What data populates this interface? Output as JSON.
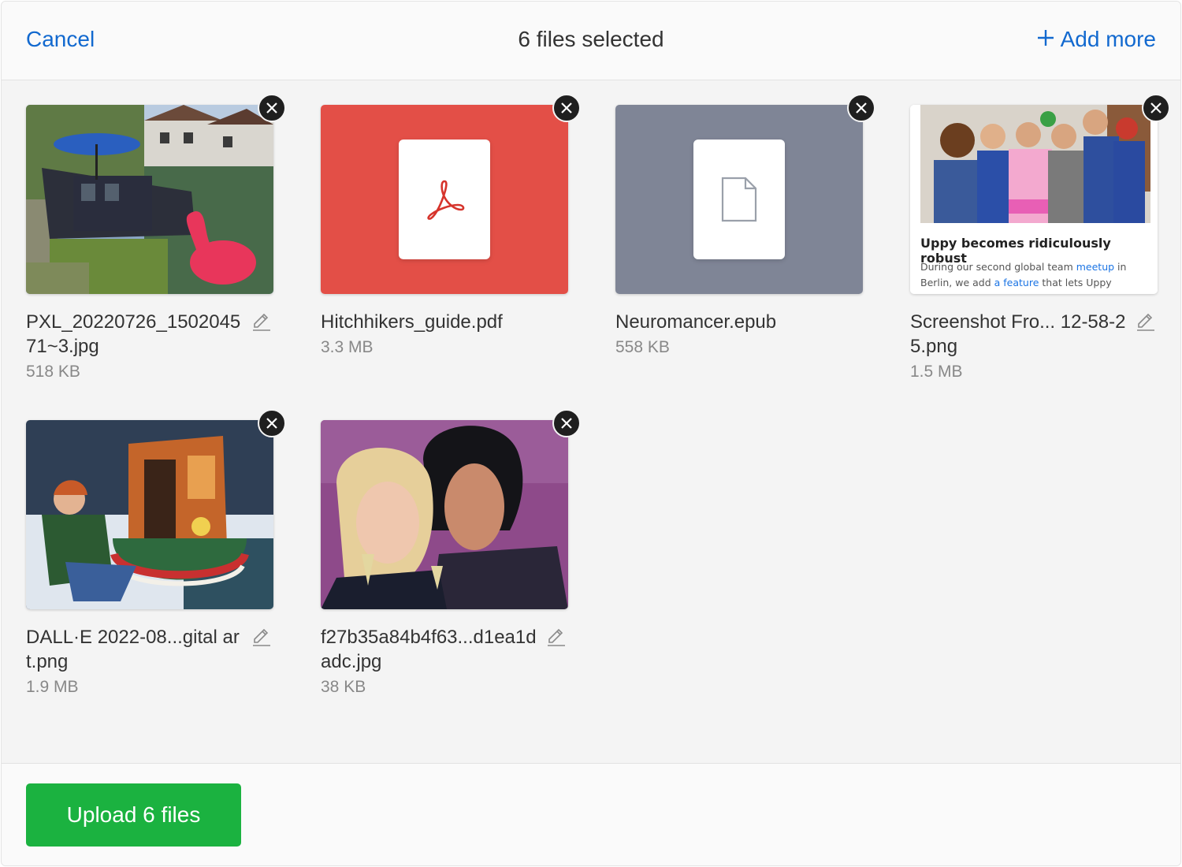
{
  "header": {
    "cancel_label": "Cancel",
    "title": "6 files selected",
    "add_more_label": "Add more"
  },
  "files": [
    {
      "name": "PXL_20220726_150204571~3.jpg",
      "size": "518 KB",
      "kind": "image",
      "editable": true
    },
    {
      "name": "Hitchhikers_guide.pdf",
      "size": "3.3 MB",
      "kind": "pdf",
      "editable": false
    },
    {
      "name": "Neuromancer.epub",
      "size": "558 KB",
      "kind": "generic",
      "editable": false
    },
    {
      "name": "Screenshot Fro... 12-58-25.png",
      "size": "1.5 MB",
      "kind": "image",
      "editable": true
    },
    {
      "name": "DALL·E 2022-08...gital art.png",
      "size": "1.9 MB",
      "kind": "image",
      "editable": true
    },
    {
      "name": "f27b35a84b4f63...d1ea1dadc.jpg",
      "size": "38 KB",
      "kind": "image",
      "editable": true
    }
  ],
  "screenshot_preview": {
    "headline": "Uppy becomes ridiculously robust",
    "body_1": "During our second global team ",
    "link_1": "meetup",
    "body_2": " in Berlin, we add ",
    "link_2": "a feature",
    "body_3": " that lets Uppy recover from unstable networks (two-powered) and browser"
  },
  "footer": {
    "upload_label": "Upload 6 files"
  },
  "colors": {
    "accent": "#1269cf",
    "upload_green": "#1bb240",
    "pdf_red": "#e34f47",
    "generic_gray": "#7f8596"
  }
}
